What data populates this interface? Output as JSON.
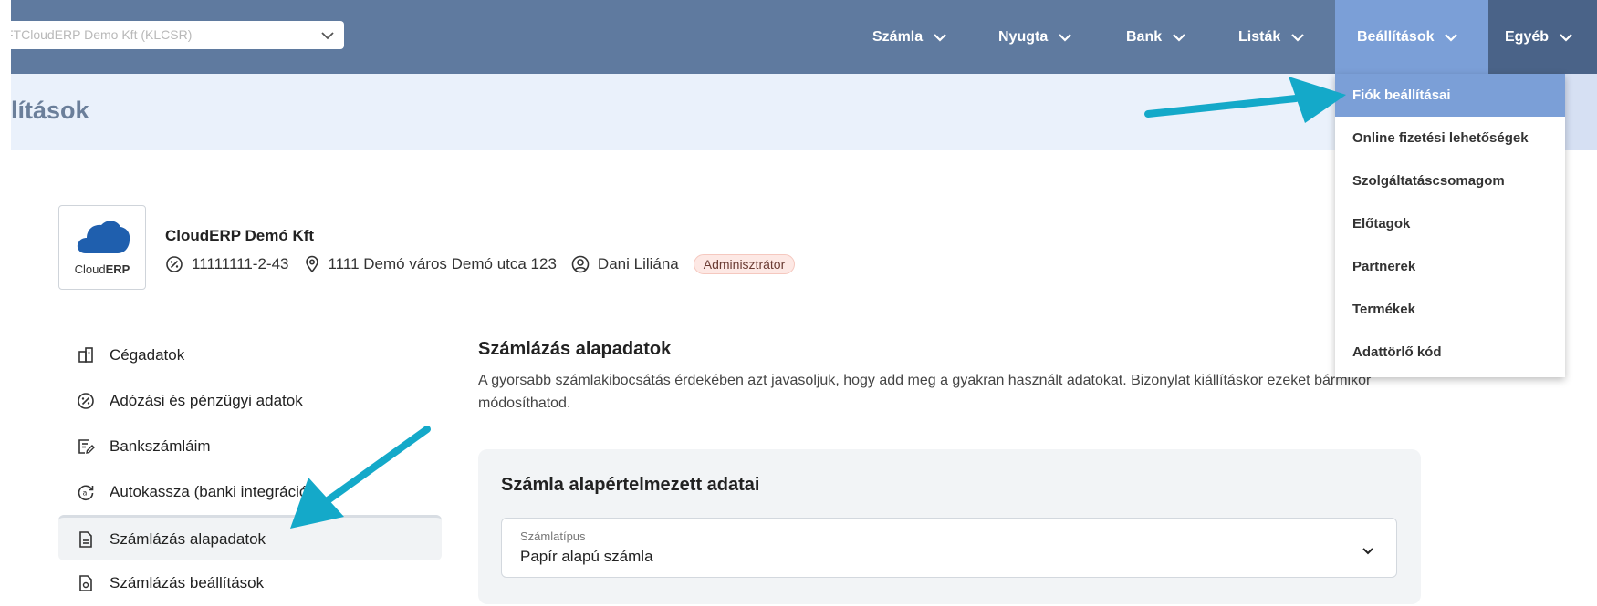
{
  "header": {
    "company_select_value": "FTCloudERP Demo Kft (KLCSR)",
    "nav": [
      {
        "label": "Számla"
      },
      {
        "label": "Nyugta"
      },
      {
        "label": "Bank"
      },
      {
        "label": "Listák"
      },
      {
        "label": "Beállítások"
      },
      {
        "label": "Egyéb"
      }
    ]
  },
  "dropdown": {
    "items": [
      {
        "label": "Fiók beállításai"
      },
      {
        "label": "Online fizetési lehetőségek"
      },
      {
        "label": "Szolgáltatáscsomagom"
      },
      {
        "label": "Előtagok"
      },
      {
        "label": "Partnerek"
      },
      {
        "label": "Termékek"
      },
      {
        "label": "Adattörlő kód"
      }
    ]
  },
  "page": {
    "title": "lítások"
  },
  "company": {
    "logo_text_light": "Cloud",
    "logo_text_bold": "ERP",
    "name": "CloudERP Demó Kft",
    "tax_number": "11111111-2-43",
    "address": "1111 Demó város Demó utca 123",
    "user": "Dani Liliána",
    "role": "Adminisztrátor"
  },
  "sidenav": {
    "items": [
      {
        "label": "Cégadatok",
        "icon": "building-icon"
      },
      {
        "label": "Adózási és pénzügyi adatok",
        "icon": "percent-icon"
      },
      {
        "label": "Bankszámláim",
        "icon": "edit-document-icon"
      },
      {
        "label": "Autokassza (banki integráció)",
        "icon": "sync-icon"
      },
      {
        "label": "Számlázás alapadatok",
        "icon": "document-icon"
      },
      {
        "label": "Számlázás beállítások",
        "icon": "document-settings-icon"
      }
    ]
  },
  "main": {
    "section_title": "Számlázás alapadatok",
    "section_desc": "A gyorsabb számlakibocsátás érdekében azt javasoljuk, hogy add meg a gyakran használt adatokat. Bizonylat kiállításkor ezeket bármikor módosíthatod.",
    "card_title": "Számla alapértelmezett adatai",
    "field_label": "Számlatípus",
    "field_value": "Papír alapú számla"
  },
  "colors": {
    "topnav": "#5f7a9f",
    "active_nav": "#7b9fd7",
    "titlebar": "#eaf1fb",
    "annotation_arrow": "#14a9c9"
  }
}
